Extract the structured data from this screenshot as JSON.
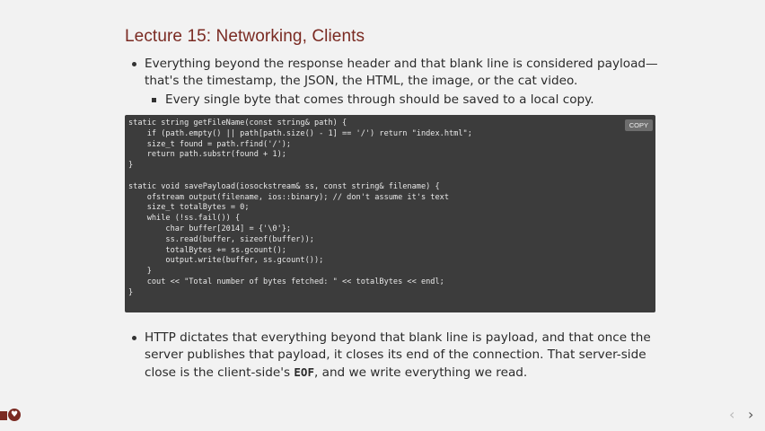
{
  "slide": {
    "title": "Lecture 15: Networking, Clients",
    "bullet1": "Everything beyond the response header and that blank line is considered payload—that's the timestamp, the JSON, the HTML, the image, or the cat video.",
    "bullet2": "Every single byte that comes through should be saved to a local copy.",
    "bullet3_part1": "HTTP dictates that everything beyond that blank line is payload, and that once the server publishes that payload, it closes its end of the connection. That server-side close is the client-side's ",
    "bullet3_code": "EOF",
    "bullet3_part2": ", and we write everything we read."
  },
  "code": {
    "copy_label": "COPY",
    "lines": [
      "static string getFileName(const string& path) {",
      "    if (path.empty() || path[path.size() - 1] == '/') return \"index.html\";",
      "    size_t found = path.rfind('/');",
      "    return path.substr(found + 1);",
      "}",
      "",
      "static void savePayload(iosockstream& ss, const string& filename) {",
      "    ofstream output(filename, ios::binary); // don't assume it's text",
      "    size_t totalBytes = 0;",
      "    while (!ss.fail()) {",
      "        char buffer[2014] = {'\\0'};",
      "        ss.read(buffer, sizeof(buffer));",
      "        totalBytes += ss.gcount();",
      "        output.write(buffer, ss.gcount());",
      "    }",
      "    cout << \"Total number of bytes fetched: \" << totalBytes << endl;",
      "}"
    ]
  },
  "nav": {
    "prev": "‹",
    "next": "›",
    "logo_glyph": "♥"
  }
}
